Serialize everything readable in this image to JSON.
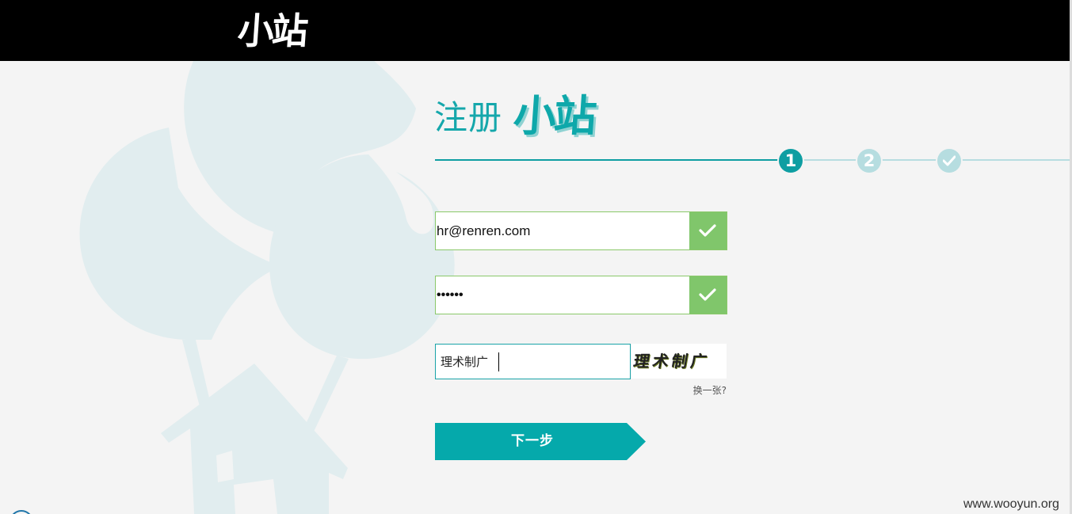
{
  "header": {
    "logo": "小站"
  },
  "title": {
    "register": "注册",
    "brand": "小站"
  },
  "steps": [
    {
      "label": "1",
      "state": "active"
    },
    {
      "label": "2",
      "state": "pending"
    },
    {
      "icon": "check-icon",
      "state": "pending"
    }
  ],
  "form": {
    "email_value": "hr@renren.com",
    "password_value": "••••••",
    "captcha_input_value": "理术制广",
    "captcha_image_text": "理术制广",
    "refresh_label": "换一张?",
    "next_label": "下一步"
  },
  "watermark": "www.wooyun.org",
  "colors": {
    "topbar": "#000000",
    "accent": "#0ea8aa",
    "valid": "#80c66b",
    "background": "#f4f4f4",
    "art": "#e1edef"
  }
}
